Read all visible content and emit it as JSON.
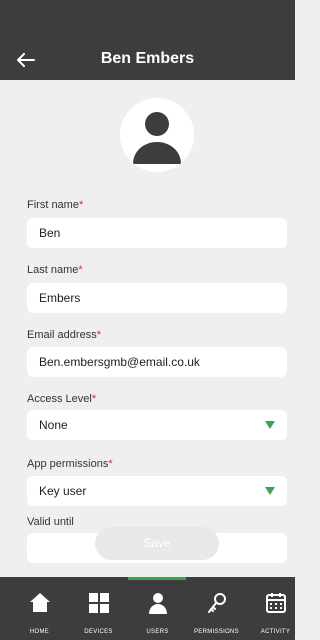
{
  "header": {
    "title": "Ben Embers"
  },
  "form": {
    "first_name": {
      "label": "First name",
      "required_mark": "*",
      "value": "Ben"
    },
    "last_name": {
      "label": "Last name",
      "required_mark": "*",
      "value": "Embers"
    },
    "email": {
      "label": "Email address",
      "required_mark": "*",
      "value": "Ben.embersgmb@email.co.uk"
    },
    "access_level": {
      "label": "Access Level",
      "required_mark": "*",
      "value": "None"
    },
    "app_permissions": {
      "label": "App permissions",
      "required_mark": "*",
      "value": "Key user"
    },
    "valid_until": {
      "label": "Valid until",
      "value": ""
    },
    "save_label": "Save"
  },
  "tabs": [
    {
      "label": "HOME",
      "icon": "home-icon"
    },
    {
      "label": "DEVICES",
      "icon": "grid-icon"
    },
    {
      "label": "USERS",
      "icon": "user-icon",
      "active": true
    },
    {
      "label": "PERMISSIONS",
      "icon": "key-icon"
    },
    {
      "label": "ACTIVITY",
      "icon": "calendar-icon"
    }
  ],
  "colors": {
    "header_bg": "#3d3d3d",
    "accent": "#3aa54a",
    "required": "#d9262b"
  }
}
